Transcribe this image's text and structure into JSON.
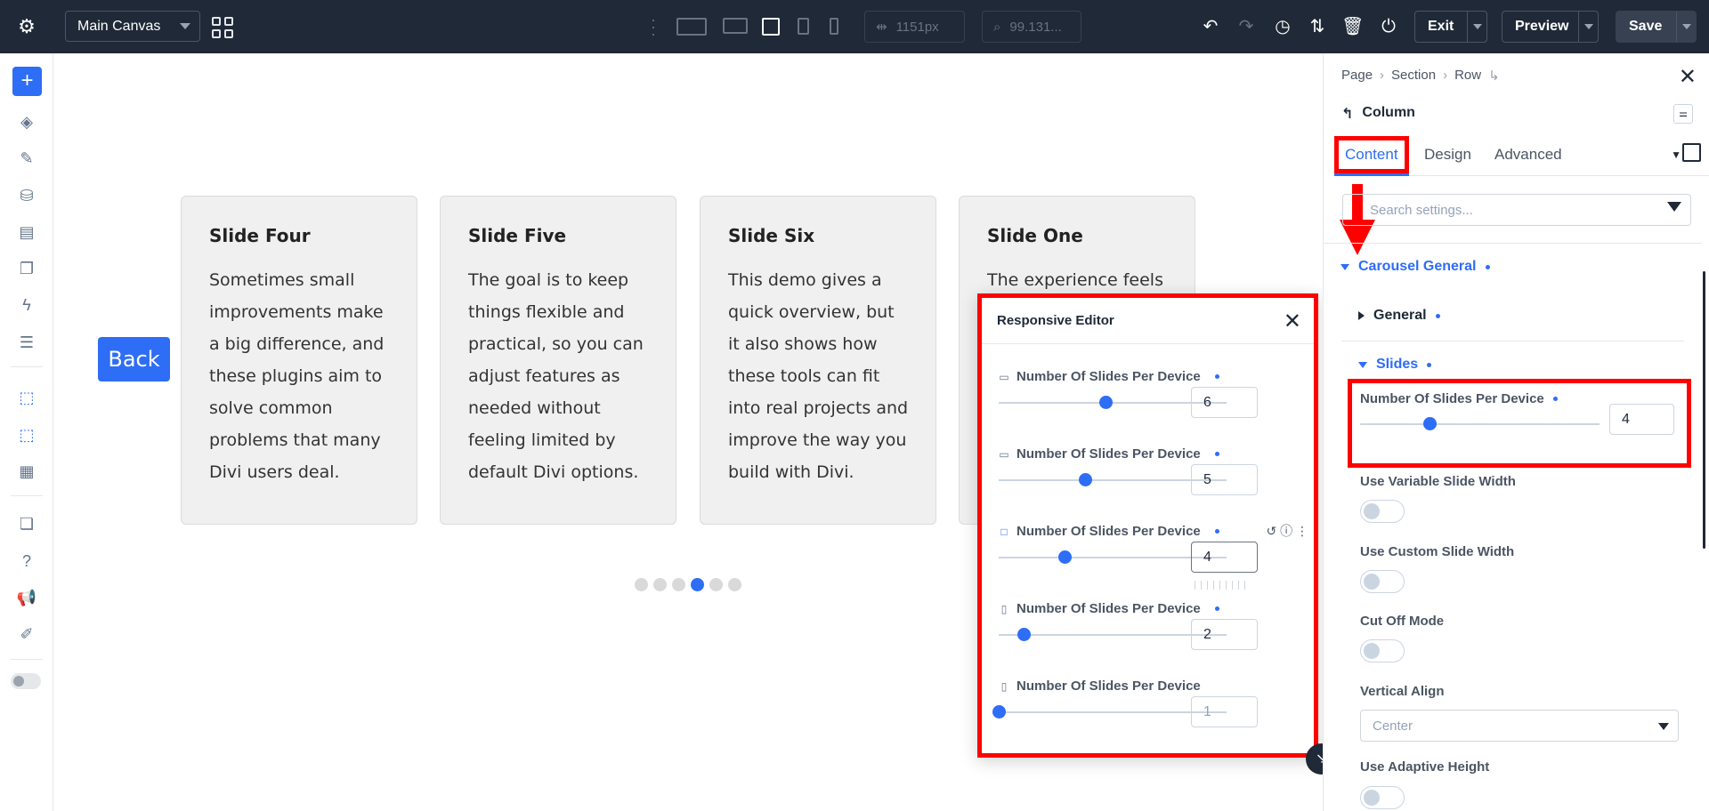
{
  "topbar": {
    "canvas_select": "Main Canvas",
    "width_value": "1151px",
    "zoom_value": "99.131...",
    "exit_label": "Exit",
    "preview_label": "Preview",
    "save_label": "Save"
  },
  "canvas": {
    "back_label": "Back",
    "slides": [
      {
        "title": "Slide Four",
        "text": "Sometimes small improvements make a big difference, and these plugins aim to solve common problems that many Divi users deal."
      },
      {
        "title": "Slide Five",
        "text": "The goal is to keep things flexible and practical, so you can adjust features as needed without feeling limited by default Divi options."
      },
      {
        "title": "Slide Six",
        "text": "This demo gives a quick overview, but it also shows how these tools can fit into real projects and improve the way you build with Divi."
      },
      {
        "title": "Slide One",
        "text": "The experience feels"
      }
    ],
    "active_dot": 4,
    "dot_count": 6
  },
  "responsive_editor": {
    "title": "Responsive Editor",
    "rows": [
      {
        "device": "desktop-large-icon",
        "label": "Number Of Slides Per Device",
        "value": "6",
        "slider_fraction": 0.47
      },
      {
        "device": "desktop-icon",
        "label": "Number Of Slides Per Device",
        "value": "5",
        "slider_fraction": 0.38
      },
      {
        "device": "tablet-landscape-icon",
        "label": "Number Of Slides Per Device",
        "value": "4",
        "slider_fraction": 0.29
      },
      {
        "device": "tablet-portrait-icon",
        "label": "Number Of Slides Per Device",
        "value": "2",
        "slider_fraction": 0.11
      },
      {
        "device": "phone-icon",
        "label": "Number Of Slides Per Device",
        "value": "1",
        "slider_fraction": 0.0
      }
    ]
  },
  "panel": {
    "breadcrumb": [
      "Page",
      "Section",
      "Row"
    ],
    "element_title": "Column",
    "tabs": [
      "Content",
      "Design",
      "Advanced"
    ],
    "search_placeholder": "Search settings...",
    "group_title": "Carousel General",
    "subgroup_general": "General",
    "subgroup_slides": "Slides",
    "slides_per_device_label": "Number Of Slides Per Device",
    "slides_per_device_value": "4",
    "slides_per_device_fraction": 0.29,
    "variable_width_label": "Use Variable Slide Width",
    "custom_width_label": "Use Custom Slide Width",
    "cut_off_label": "Cut Off Mode",
    "vertical_align_label": "Vertical Align",
    "vertical_align_value": "Center",
    "adaptive_height_label": "Use Adaptive Height"
  },
  "colors": {
    "accent": "#2e6df6",
    "highlight": "#ff0000",
    "topbar": "#1f2937"
  }
}
